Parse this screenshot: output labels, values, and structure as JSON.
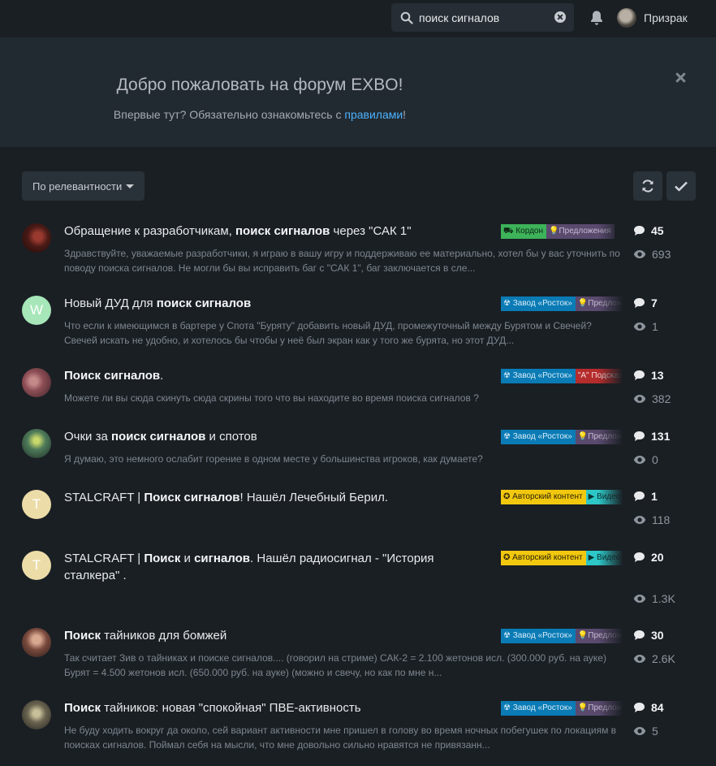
{
  "header": {
    "search_value": "поиск сигналов",
    "username": "Призрак"
  },
  "hero": {
    "title": "Добро пожаловать на форум EXBO!",
    "subtitle_before": "Впервые тут? Обязательно ознакомьтесь с ",
    "subtitle_link": "правилами",
    "subtitle_after": "!"
  },
  "toolbar": {
    "sort_label": "По релевантности"
  },
  "colors": {
    "accent_link": "#4cb2ff",
    "tag_kordon": "#3db35a",
    "tag_zavod": "#0a7bb5",
    "tag_predlozheniya": "#5a4a6e",
    "tag_podsказки_red": "#b52c2c",
    "tag_author": "#f2c80f",
    "tag_video": "#2ec7c7"
  },
  "topics": [
    {
      "title_parts": [
        "Обращение к разработчикам, ",
        "поиск сигналов",
        " через \"САК 1\""
      ],
      "excerpt": "Здравствуйте, уважаемые разработчики, я играю в вашу игру и поддерживаю ее материально, хотел бы у вас уточнить по поводу поиска сигналов. Не могли бы вы исправить баг с \"САК 1\", баг заключается в сле...",
      "tags": [
        "Кордон",
        "Предложения"
      ],
      "replies": "45",
      "views": "693"
    },
    {
      "title_parts": [
        "Новый ДУД для ",
        "поиск сигналов",
        ""
      ],
      "avatar_letter": "W",
      "excerpt": "Что если к имеющимся в бартере у Спота \"Буряту\" добавить новый ДУД, промежуточный между Бурятом и Свечей? Свечей искать не удобно, и хотелось бы чтобы у неё был экран как у того же бурята, но этот ДУД...",
      "tags": [
        "Завод «Росток»",
        "Предложения"
      ],
      "replies": "7",
      "views": "1"
    },
    {
      "title_parts": [
        "",
        "Поиск сигналов",
        "."
      ],
      "excerpt": "Можете ли вы сюда скинуть сюда скрины того что вы находите во время поиска сигналов ?",
      "tags": [
        "Завод «Росток»",
        "\"А\" Подсказки"
      ],
      "replies": "13",
      "views": "382"
    },
    {
      "title_parts": [
        "Очки за ",
        "поиск сигналов",
        " и спотов"
      ],
      "excerpt": "Я думаю, это немного ослабит горение в одном месте у большинства игроков, как думаете?",
      "tags": [
        "Завод «Росток»",
        "Предложения"
      ],
      "replies": "131",
      "views": "0"
    },
    {
      "title_parts": [
        "STALCRAFT | ",
        "Поиск сигналов",
        "! Нашёл Лечебный Берил."
      ],
      "avatar_letter": "T",
      "excerpt": "",
      "tags": [
        "Авторский контент",
        "Видео"
      ],
      "replies": "1",
      "views": "118"
    },
    {
      "title_a": "STALCRAFT | ",
      "title_b": "Поиск",
      "title_c": " и ",
      "title_d": "сигналов",
      "title_e": ". Нашёл радиосигнал - \"История сталкера\" .",
      "avatar_letter": "T",
      "tags": [
        "Авторский контент",
        "Видео"
      ],
      "replies": "20",
      "views": "1.3K"
    },
    {
      "title_parts": [
        "",
        "Поиск",
        " тайников для бомжей"
      ],
      "excerpt": "Так считает Зив о тайниках и поиске сигналов.... (говорил на стриме) САК-2 = 2.100 жетонов исл. (300.000 руб. на ауке) Бурят = 4.500 жетонов исл. (650.000 руб. на ауке) (можно и свечу, но как по мне н...",
      "tags": [
        "Завод «Росток»",
        "Предложения"
      ],
      "replies": "30",
      "views": "2.6K"
    },
    {
      "title_parts": [
        "",
        "Поиск",
        " тайников: новая \"спокойная\" ПВЕ-активность"
      ],
      "excerpt": "Не буду ходить вокруг да около, сей вариант активности мне пришел в голову во время ночных побегушек по локациям в поисках сигналов. Поймал себя на мысли, что мне довольно сильно нравятся не привязанн...",
      "tags": [
        "Завод «Росток»",
        "Предложения"
      ],
      "replies": "84",
      "views": "5"
    }
  ]
}
